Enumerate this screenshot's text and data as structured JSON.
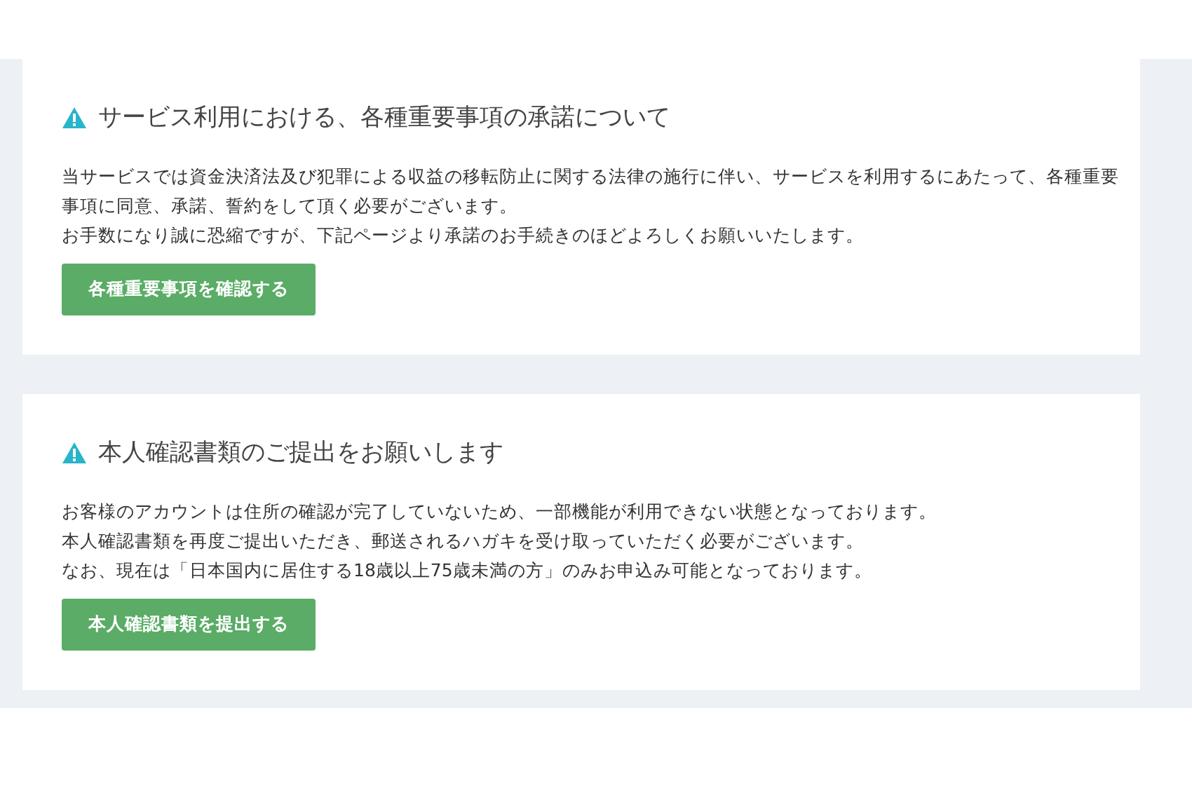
{
  "notices": [
    {
      "title": "サービス利用における、各種重要事項の承諾について",
      "paragraphs": [
        "当サービスでは資金決済法及び犯罪による収益の移転防止に関する法律の施行に伴い、サービスを利用するにあたって、各種重要事項に同意、承諾、誓約をして頂く必要がございます。",
        "お手数になり誠に恐縮ですが、下記ページより承諾のお手続きのほどよろしくお願いいたします。"
      ],
      "button": "各種重要事項を確認する"
    },
    {
      "title": "本人確認書類のご提出をお願いします",
      "paragraphs": [
        "お客様のアカウントは住所の確認が完了していないため、一部機能が利用できない状態となっております。",
        "本人確認書類を再度ご提出いただき、郵送されるハガキを受け取っていただく必要がございます。",
        "なお、現在は「日本国内に居住する18歳以上75歳未満の方」のみお申込み可能となっております。"
      ],
      "button": "本人確認書類を提出する"
    }
  ]
}
